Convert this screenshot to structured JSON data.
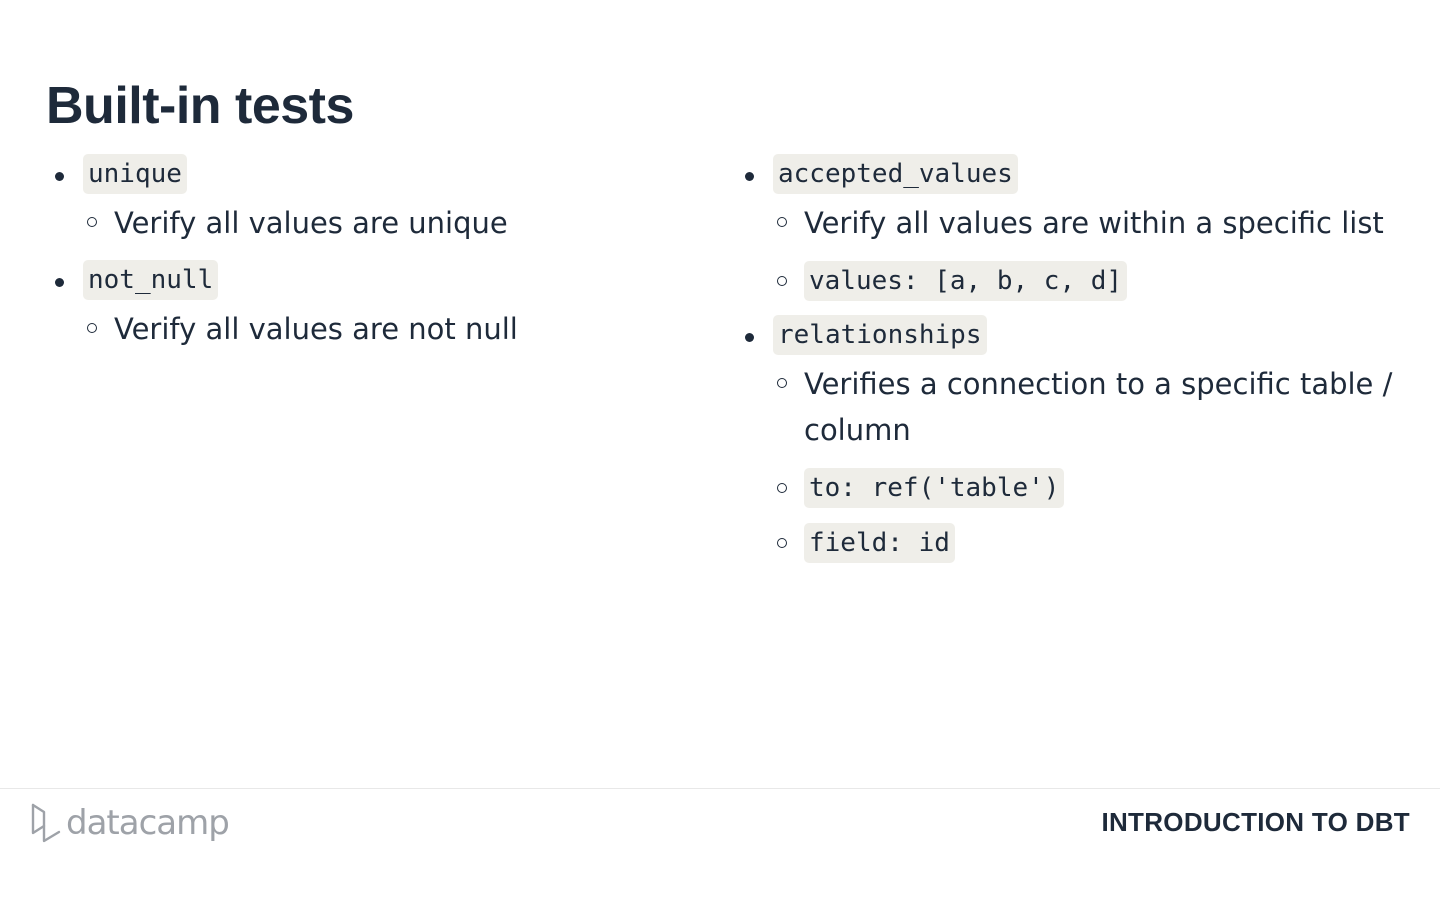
{
  "slide": {
    "title": "Built-in tests"
  },
  "left_column": {
    "items": [
      {
        "code": "unique",
        "subitems": [
          {
            "text": "Verify all values are unique"
          }
        ]
      },
      {
        "code": "not_null",
        "subitems": [
          {
            "text": "Verify all values are not null"
          }
        ]
      }
    ]
  },
  "right_column": {
    "items": [
      {
        "code": "accepted_values",
        "subitems": [
          {
            "text": "Verify all values are within a specific list"
          },
          {
            "code": "values: [a, b, c, d]"
          }
        ]
      },
      {
        "code": "relationships",
        "subitems": [
          {
            "text": "Verifies a connection to a specific table / column"
          },
          {
            "code": "to: ref('table')"
          },
          {
            "code": "field: id"
          }
        ]
      }
    ]
  },
  "footer": {
    "logo_text": "datacamp",
    "course_title": "INTRODUCTION TO DBT",
    "logo_color": "#9ea2a8"
  }
}
